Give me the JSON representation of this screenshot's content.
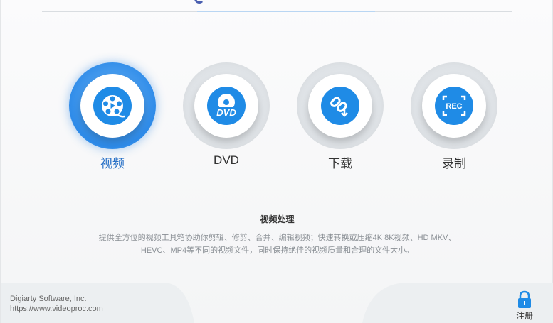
{
  "features": [
    {
      "label": "视频",
      "icon": "film-reel-icon"
    },
    {
      "label": "DVD",
      "icon": "dvd-disc-icon"
    },
    {
      "label": "下载",
      "icon": "link-download-icon"
    },
    {
      "label": "录制",
      "icon": "rec-capture-icon"
    }
  ],
  "dvd_icon_text": "DVD",
  "rec_icon_text": "REC",
  "description": {
    "title": "视频处理",
    "line1": "提供全方位的视频工具箱协助你剪辑、修剪、合并、编辑视频；快速转换或压缩4K 8K视频、HD MKV、",
    "line2": "HEVC、MP4等不同的视频文件，同时保持绝佳的视频质量和合理的文件大小。"
  },
  "footer": {
    "company": "Digiarty Software, Inc.",
    "url": "https://www.videoproc.com",
    "register_label": "注册"
  },
  "colors": {
    "accent": "#1f8be6",
    "active_label": "#2a72c7"
  }
}
